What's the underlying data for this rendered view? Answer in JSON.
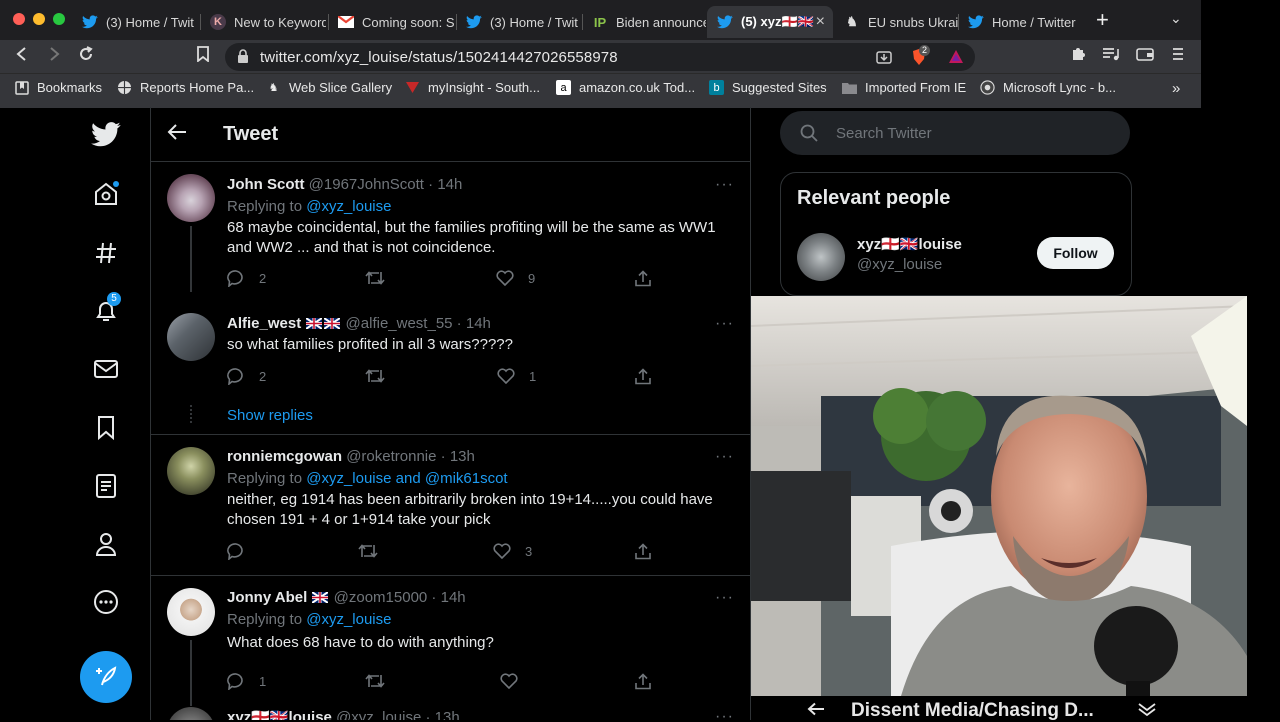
{
  "browser": {
    "tabs": [
      {
        "title": "(3) Home / Twit",
        "icon": "twitter-icon"
      },
      {
        "title": "New to Keyword",
        "icon": "keyword-icon"
      },
      {
        "title": "Coming soon: S",
        "icon": "gmail-icon"
      },
      {
        "title": "(3) Home / Twit",
        "icon": "twitter-icon"
      },
      {
        "title": "Biden announce",
        "icon": "ip-icon"
      },
      {
        "title": "(5) xyz🏴󠁧󠁢󠁥󠁮󠁧󠁿🇬🇧",
        "icon": "twitter-icon",
        "active": true
      },
      {
        "title": "EU snubs Ukrai",
        "icon": "unicorn-icon"
      },
      {
        "title": "Home / Twitter",
        "icon": "twitter-icon"
      }
    ],
    "url": "twitter.com/xyz_louise/status/1502414427026558978",
    "brave_badge": "2",
    "bookmarks": [
      {
        "label": "Bookmarks",
        "icon": "bookmarks-icon"
      },
      {
        "label": "Reports Home Pa...",
        "icon": "globe-icon"
      },
      {
        "label": "Web Slice Gallery",
        "icon": "unicorn-icon"
      },
      {
        "label": "myInsight - South...",
        "icon": "myinsight-icon"
      },
      {
        "label": "amazon.co.uk Tod...",
        "icon": "amazon-icon"
      },
      {
        "label": "Suggested Sites",
        "icon": "bing-icon"
      },
      {
        "label": "Imported From IE",
        "icon": "folder-icon"
      },
      {
        "label": "Microsoft Lync - b...",
        "icon": "lync-icon"
      }
    ],
    "more_bookmarks": "»"
  },
  "twitter_nav": {
    "notifications_badge": "5"
  },
  "header": {
    "title": "Tweet"
  },
  "tweets": [
    {
      "name": "John Scott",
      "handle": "@1967JohnScott",
      "time": "14h",
      "replying_prefix": "Replying to ",
      "replying_to": "@xyz_louise",
      "text": "68 maybe coincidental, but the families profiting will be the same as WW1 and WW2 ... and that is not coincidence.",
      "replies": "2",
      "retweets": "",
      "likes": "9"
    },
    {
      "name": "Alfie_west",
      "handle": "@alfie_west_55",
      "time": "14h",
      "text": "so what families profited in all 3 wars?????",
      "replies": "2",
      "retweets": "",
      "likes": "1",
      "show_replies": "Show replies"
    },
    {
      "name": "ronniemcgowan",
      "handle": "@roketronnie",
      "time": "13h",
      "replying_prefix": "Replying to ",
      "replying_to": "@xyz_louise and @mik61scot",
      "text": "neither, eg 1914 has been arbitrarily broken into 19+14.....you could have chosen 191 + 4 or 1+914 take your pick",
      "replies": "",
      "retweets": "",
      "likes": "3"
    },
    {
      "name": "Jonny Abel",
      "handle": "@zoom15000",
      "time": "14h",
      "replying_prefix": "Replying to ",
      "replying_to": "@xyz_louise",
      "text": "What does 68 have to do with anything?",
      "replies": "1",
      "retweets": "",
      "likes": ""
    },
    {
      "name": "xyz🏴󠁧󠁢󠁥󠁮󠁧󠁿🇬🇧louise",
      "handle": "@xyz_louise",
      "time": "13h"
    }
  ],
  "meta_separator": " · ",
  "search": {
    "placeholder": "Search Twitter"
  },
  "relevant": {
    "title": "Relevant people",
    "name": "xyz🏴󠁧󠁢󠁥󠁮󠁧󠁿🇬🇧louise",
    "handle": "@xyz_louise",
    "follow_label": "Follow"
  },
  "webcam_bar": {
    "title": "Dissent Media/Chasing D..."
  },
  "colors": {
    "accent": "#1d9bf0",
    "background": "#000000",
    "text_secondary": "#71767b"
  }
}
